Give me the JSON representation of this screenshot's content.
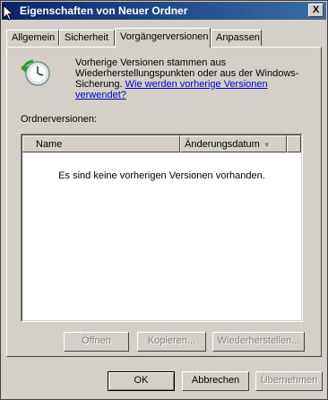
{
  "window": {
    "title": "Eigenschaften von Neuer Ordner",
    "close_label": "X"
  },
  "tabs": [
    {
      "label": "Allgemein"
    },
    {
      "label": "Sicherheit"
    },
    {
      "label": "Vorgängerversionen"
    },
    {
      "label": "Anpassen"
    }
  ],
  "active_tab": "Vorgängerversionen",
  "description": {
    "text": "Vorherige Versionen stammen aus Wiederherstellungspunkten oder aus der Windows-Sicherung.",
    "link": "Wie werden vorherige Versionen verwendet?"
  },
  "versions": {
    "label": "Ordnerversionen:",
    "columns": [
      "Name",
      "Änderungsdatum"
    ],
    "empty_message": "Es sind keine vorherigen Versionen vorhanden.",
    "rows": []
  },
  "actions": {
    "open": "Öffnen",
    "copy": "Kopieren...",
    "restore": "Wiederherstellen..."
  },
  "dialog_buttons": {
    "ok": "OK",
    "cancel": "Abbrechen",
    "apply": "Übernehmen"
  },
  "icons": {
    "clock": "history-clock-icon",
    "close": "close-icon"
  }
}
